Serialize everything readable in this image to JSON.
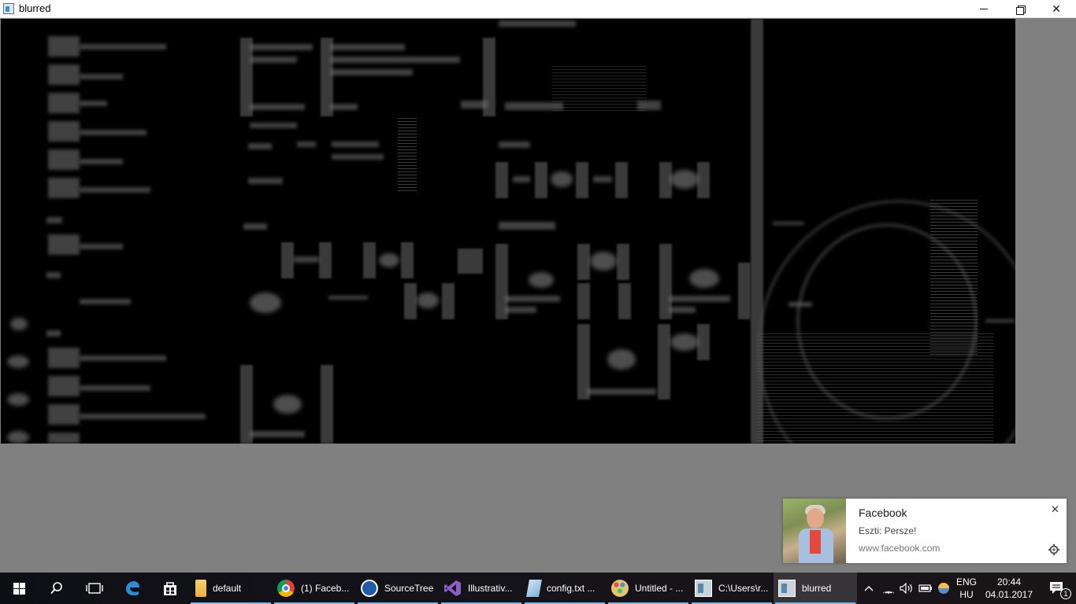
{
  "window": {
    "title": "blurred",
    "controls": [
      "minimize",
      "restore",
      "close"
    ]
  },
  "notification": {
    "app": "Facebook",
    "message": "Eszti: Persze!",
    "source": "www.facebook.com",
    "icons": [
      "close-icon",
      "settings-gear-icon",
      "profile-photo"
    ]
  },
  "taskbar": {
    "pinned_icons": [
      "windows-start-icon",
      "search-icon",
      "task-view-icon",
      "edge-icon",
      "store-icon"
    ],
    "apps": [
      {
        "label": "default",
        "icon": "folder-icon",
        "color": "#f3c13a"
      },
      {
        "label": "(1) Faceb...",
        "icon": "chrome-icon",
        "color": "#db4437"
      },
      {
        "label": "SourceTree",
        "icon": "sourcetree-icon",
        "color": "#1f5da8"
      },
      {
        "label": "Illustrativ...",
        "icon": "visual-studio-icon",
        "color": "#8b5fc7"
      },
      {
        "label": "config.txt ...",
        "icon": "notepad-icon",
        "color": "#7fb2d9"
      },
      {
        "label": "Untitled - ...",
        "icon": "paint-icon",
        "color": "#e8c170"
      },
      {
        "label": "C:\\Users\\r...",
        "icon": "console-icon",
        "color": "#c9d3dc"
      },
      {
        "label": "blurred",
        "icon": "blurred-app-icon",
        "color": "#c9d3dc",
        "active": true
      }
    ],
    "language": {
      "top": "ENG",
      "bottom": "HU"
    },
    "clock": {
      "time": "20:44",
      "date": "04.01.2017"
    },
    "notification_count": "1"
  }
}
